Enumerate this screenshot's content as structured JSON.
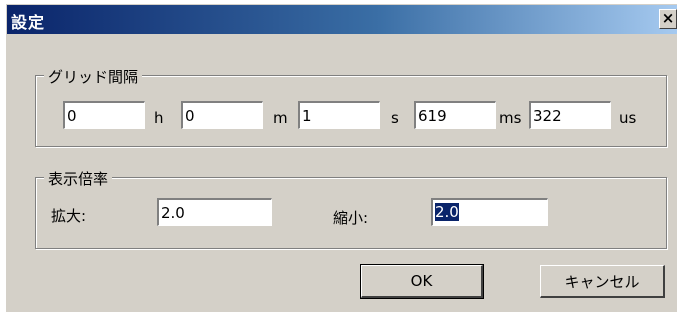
{
  "window": {
    "title": "設定",
    "close_glyph": "×"
  },
  "grid": {
    "label": "グリッド間隔",
    "fields": [
      {
        "value": "0",
        "unit": "h"
      },
      {
        "value": "0",
        "unit": "m"
      },
      {
        "value": "1",
        "unit": "s"
      },
      {
        "value": "619",
        "unit": "ms"
      },
      {
        "value": "322",
        "unit": "us"
      }
    ]
  },
  "zoom": {
    "label": "表示倍率",
    "expand_label": "拡大:",
    "expand_value": "2.0",
    "shrink_label": "縮小:",
    "shrink_value": "2.0"
  },
  "buttons": {
    "ok": "OK",
    "cancel": "キャンセル"
  }
}
